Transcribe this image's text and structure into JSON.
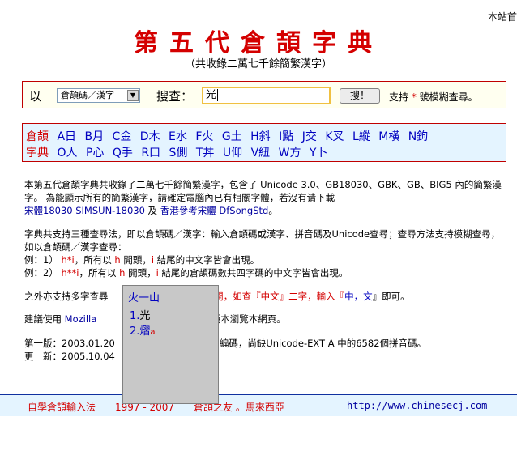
{
  "header": {
    "topright": "本站首",
    "title": "第五代倉頡字典",
    "subtitle": "（共收錄二萬七千餘簡繁漢字）"
  },
  "search": {
    "prefix_label": "以",
    "mode_selected": "倉頡碼／漢字",
    "search_label": "搜查：",
    "query_value": "光",
    "button_label": "搜！",
    "support_text_before": "支持",
    "support_star": "*",
    "support_text_after": "號模糊查尋。"
  },
  "radicals": {
    "row1_head": "倉頡",
    "row1": [
      "A日",
      "B月",
      "C金",
      "D木",
      "E水",
      "F火",
      "G土",
      "H斜",
      "I點",
      "J交",
      "K叉",
      "L縱",
      "M橫",
      "N鉤"
    ],
    "row2_head": "字典",
    "row2": [
      "O人",
      "P心",
      "Q手",
      "R口",
      "S側",
      "T丼",
      "U仰",
      "V紐",
      "W方",
      "Y卜"
    ]
  },
  "intro": {
    "p1": "本第五代倉頡字典共收錄了二萬七千餘簡繁漢字，包含了 Unicode 3.0、GB18030、GBK、GB、BIG5 內的簡繁漢字。 為能顯示所有的簡繁漢字，請確定電腦內已有相關字體，若沒有请下載",
    "font_link1": "宋體18030 SIMSUN-18030",
    "p1_and": " 及 ",
    "font_link2": "香港參考宋體 DfSongStd",
    "p1_end": "。"
  },
  "methods": {
    "line1": "字典共支持三種查尋法，即以倉頡碼／漢字：輸入倉頡碼或漢字、拼音碼及Unicode查尋；查尋方法支持模糊查尋，如以倉頡碼／漢字查尋：",
    "ex1_a": "例：1）",
    "ex1_code": "h*i",
    "ex1_b": "，所有以",
    "ex1_h": "h",
    "ex1_c": "開頭，",
    "ex1_i": "i",
    "ex1_d": "結尾的中文字皆會出現。",
    "ex2_a": "例：2）",
    "ex2_code": "h**i",
    "ex2_b": "，所有以",
    "ex2_h": "h",
    "ex2_c": "開頭，",
    "ex2_i": "i",
    "ex2_d": "結尾的倉頡碼數共四字碼的中文字皆會出現。"
  },
  "multi": {
    "a": "之外亦支持多字查尋",
    "b": "號(,)分開，如查『中文』二字，輸入『",
    "chars": "中，文",
    "c": "』即可。"
  },
  "browser": {
    "a": "建議使用",
    "link": "Mozilla",
    "b": "的版本瀏覽本網頁。"
  },
  "version": {
    "first_a": "第一版：2003.01.20",
    "first_b": "8 編碼，尚缺Unicode-EXT A 中的6582個拼音碼。",
    "update": "更　新：2005.10.04"
  },
  "footer": {
    "left": "自學倉頡輸入法　　1997 - 2007　　倉頡之友 。馬來西亞",
    "url": "http://www.chinesecj.com"
  },
  "ime": {
    "composition": "火一山",
    "candidates": [
      {
        "num": "1.",
        "char": "光",
        "hint": ""
      },
      {
        "num": "2.",
        "char": "熠",
        "hint": "a"
      }
    ]
  },
  "colors": {
    "title": "#d40000",
    "radical_bg": "#e4f4ff",
    "searchbar_border": "#c00000",
    "link": "#0000a0"
  }
}
